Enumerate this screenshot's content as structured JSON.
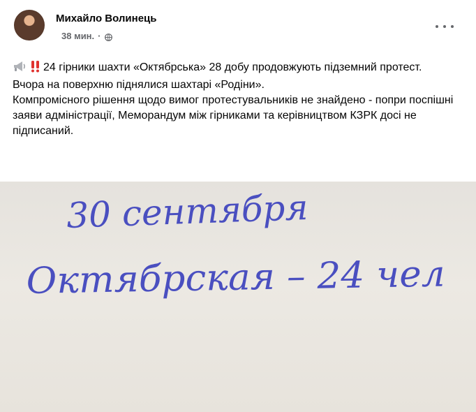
{
  "post": {
    "author": "Михайло Волинець",
    "time": "38 мин.",
    "privacy_icon": "globe-icon",
    "menu_icon": "more-options-icon",
    "text_line1": "24 гірники шахти «Октябрська» 28 добу продовжують підземний протест.",
    "text_line2": "Вчора на поверхню піднялися шахтарі «Родіни».",
    "text_line3": "Компромісного рішення щодо вимог протестувальників не знайдено - попри поспішні заяви адміністрації, Меморандум між гірниками та керівництвом КЗРК досі не підписаний."
  },
  "photo": {
    "line1": "30 сентября",
    "line2": "Октябрская – 24 чел",
    "ink_color": "#4a4fc0"
  }
}
